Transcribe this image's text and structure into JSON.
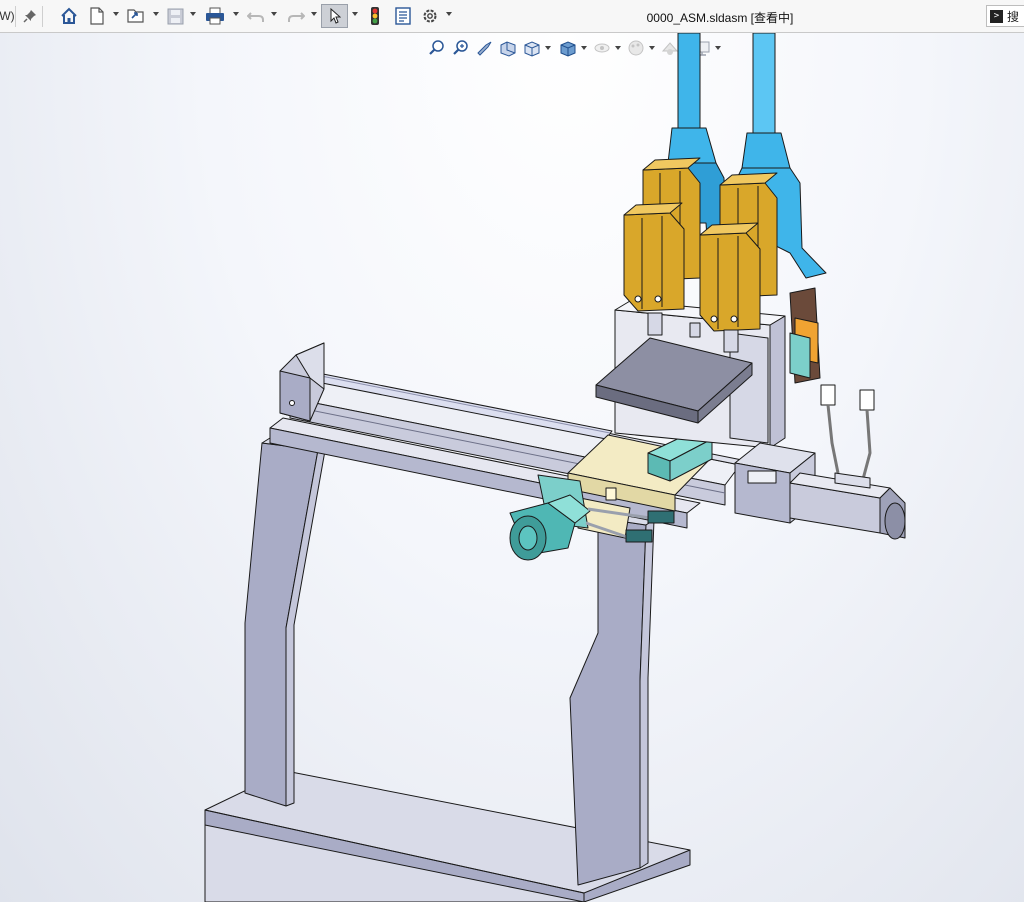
{
  "toolbar": {
    "left_fragment": "W)",
    "icons": [
      "pin-icon",
      "home-icon",
      "new-doc-icon",
      "open-icon",
      "save-icon",
      "print-icon",
      "undo-icon",
      "redo-icon",
      "select-arrow-icon",
      "traffic-light-icon",
      "file-properties-icon",
      "options-gear-icon"
    ]
  },
  "document": {
    "title": "0000_ASM.sldasm [查看中]"
  },
  "search": {
    "label": "搜"
  },
  "heads_up_toolbar": {
    "icons": [
      "zoom-to-fit-icon",
      "zoom-to-area-icon",
      "previous-view-icon",
      "section-view-icon",
      "view-orientation-icon",
      "display-style-icon",
      "hide-show-icon",
      "edit-appearance-icon",
      "apply-scene-icon",
      "view-settings-icon"
    ]
  },
  "colors": {
    "toolbar_bg": "#f7f7f7",
    "frame": "#a9acc6",
    "frame_light": "#d9dbe8",
    "cylinder_gold": "#d9a72a",
    "tube_blue": "#3fb5ea",
    "motor_teal": "#4fb7b4",
    "slider_cream": "#f3ebc4"
  }
}
